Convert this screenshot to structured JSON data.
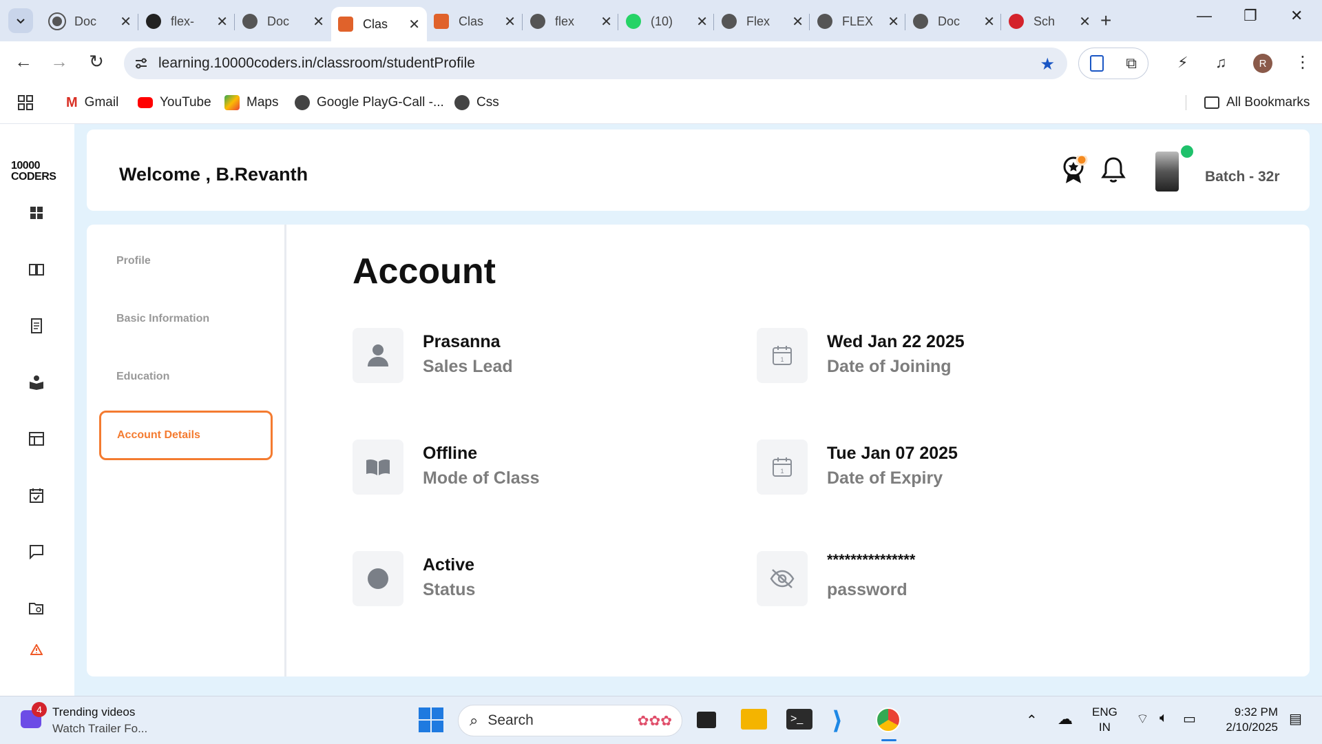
{
  "browser": {
    "tabs": [
      {
        "title": "Doc",
        "icon": "globe-icon"
      },
      {
        "title": "flex-",
        "icon": "github-icon"
      },
      {
        "title": "Doc",
        "icon": "globe-icon"
      },
      {
        "title": "Clas",
        "icon": "coders-icon",
        "active": true
      },
      {
        "title": "Clas",
        "icon": "coders-icon"
      },
      {
        "title": "flex",
        "icon": "globe-icon"
      },
      {
        "title": "(10)",
        "icon": "whatsapp-icon"
      },
      {
        "title": "Flex",
        "icon": "globe-icon"
      },
      {
        "title": "FLEX",
        "icon": "globe-icon"
      },
      {
        "title": "Doc",
        "icon": "globe-icon"
      },
      {
        "title": "Sch",
        "icon": "m-icon"
      }
    ],
    "url": "learning.10000coders.in/classroom/studentProfile",
    "profile_initial": "R",
    "bookmarks": [
      {
        "label": "Gmail",
        "icon": "gmail-icon"
      },
      {
        "label": "YouTube",
        "icon": "youtube-icon"
      },
      {
        "label": "Maps",
        "icon": "maps-icon"
      },
      {
        "label": "Google PlayG-Call -...",
        "icon": "globe-icon"
      },
      {
        "label": "Css",
        "icon": "globe-icon"
      }
    ],
    "all_bookmarks": "All Bookmarks"
  },
  "app": {
    "logo": {
      "line1": "10000",
      "line2": "CODERS"
    },
    "header": {
      "welcome": "Welcome , B.Revanth",
      "batch": "Batch - 32r"
    },
    "menu": {
      "items": [
        "Profile",
        "Basic Information",
        "Education"
      ],
      "active": "Account Details"
    },
    "account": {
      "title": "Account",
      "fields": [
        {
          "value": "Prasanna",
          "label": "Sales Lead",
          "icon": "user-icon"
        },
        {
          "value": "Wed Jan 22 2025",
          "label": "Date of Joining",
          "icon": "calendar-icon"
        },
        {
          "value": "Offline",
          "label": "Mode of Class",
          "icon": "book-icon"
        },
        {
          "value": "Tue Jan 07 2025",
          "label": "Date of Expiry",
          "icon": "calendar-icon"
        },
        {
          "value": "Active",
          "label": "Status",
          "icon": "status-dot-icon"
        },
        {
          "value": "***************",
          "label": "password",
          "icon": "eye-off-icon"
        }
      ]
    }
  },
  "taskbar": {
    "notification_count": "4",
    "news_title": "Trending videos",
    "news_sub": "Watch Trailer Fo...",
    "search_placeholder": "Search",
    "lang_line1": "ENG",
    "lang_line2": "IN",
    "time": "9:32 PM",
    "date": "2/10/2025"
  },
  "colors": {
    "accent_orange": "#f47b30",
    "online_green": "#1fc16b",
    "page_bg": "#e3f2fc",
    "star_blue": "#1a56c4"
  }
}
